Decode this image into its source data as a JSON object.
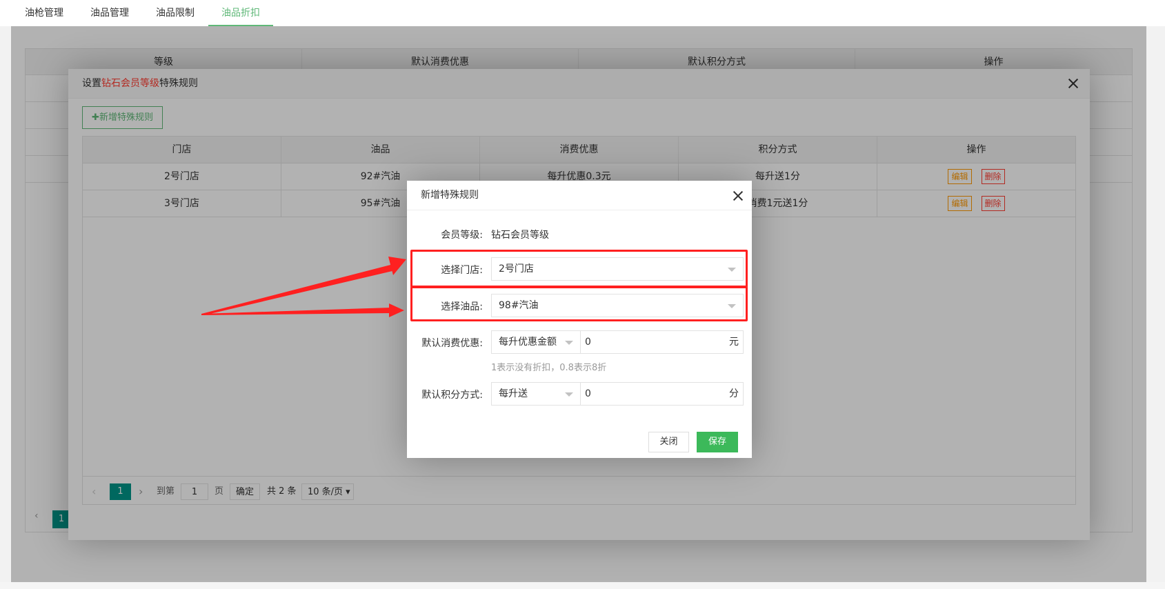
{
  "tabs": [
    {
      "label": "油枪管理"
    },
    {
      "label": "油品管理"
    },
    {
      "label": "油品限制"
    },
    {
      "label": "油品折扣"
    }
  ],
  "base_table": {
    "headers": [
      "等级",
      "默认消费优惠",
      "默认积分方式",
      "操作"
    ],
    "current_page": "1"
  },
  "outer_dialog": {
    "title_prefix": "设置",
    "title_highlight": "钻石会员等级",
    "title_suffix": "特殊规则",
    "add_button": "✚新增特殊规则",
    "headers": [
      "门店",
      "油品",
      "消费优惠",
      "积分方式",
      "操作"
    ],
    "rows": [
      {
        "store": "2号门店",
        "oil": "92#汽油",
        "discount": "每升优惠0.3元",
        "points": "每升送1分"
      },
      {
        "store": "3号门店",
        "oil": "95#汽油",
        "discount": "",
        "points": "消费1元送1分"
      }
    ],
    "edit_label": "编辑",
    "delete_label": "删除",
    "pager": {
      "current": "1",
      "goto_label": "到第",
      "goto_value": "1",
      "page_unit": "页",
      "confirm": "确定",
      "total": "共 2 条",
      "page_size": "10 条/页 ▾"
    }
  },
  "inner_dialog": {
    "title": "新增特殊规则",
    "member_level_label": "会员等级:",
    "member_level_value": "钻石会员等级",
    "store_label": "选择门店:",
    "store_value": "2号门店",
    "oil_label": "选择油品:",
    "oil_value": "98#汽油",
    "discount_label": "默认消费优惠:",
    "discount_type": "每升优惠金额",
    "discount_value": "0",
    "discount_unit": "元",
    "discount_hint": "1表示没有折扣，0.8表示8折",
    "points_label": "默认积分方式:",
    "points_type": "每升送",
    "points_value": "0",
    "points_unit": "分",
    "close_button": "关闭",
    "save_button": "保存"
  },
  "colors": {
    "accent_green": "#5fb878",
    "save_green": "#3cb95a",
    "highlight_red": "#ff2020",
    "edit_orange": "#ff9900"
  }
}
